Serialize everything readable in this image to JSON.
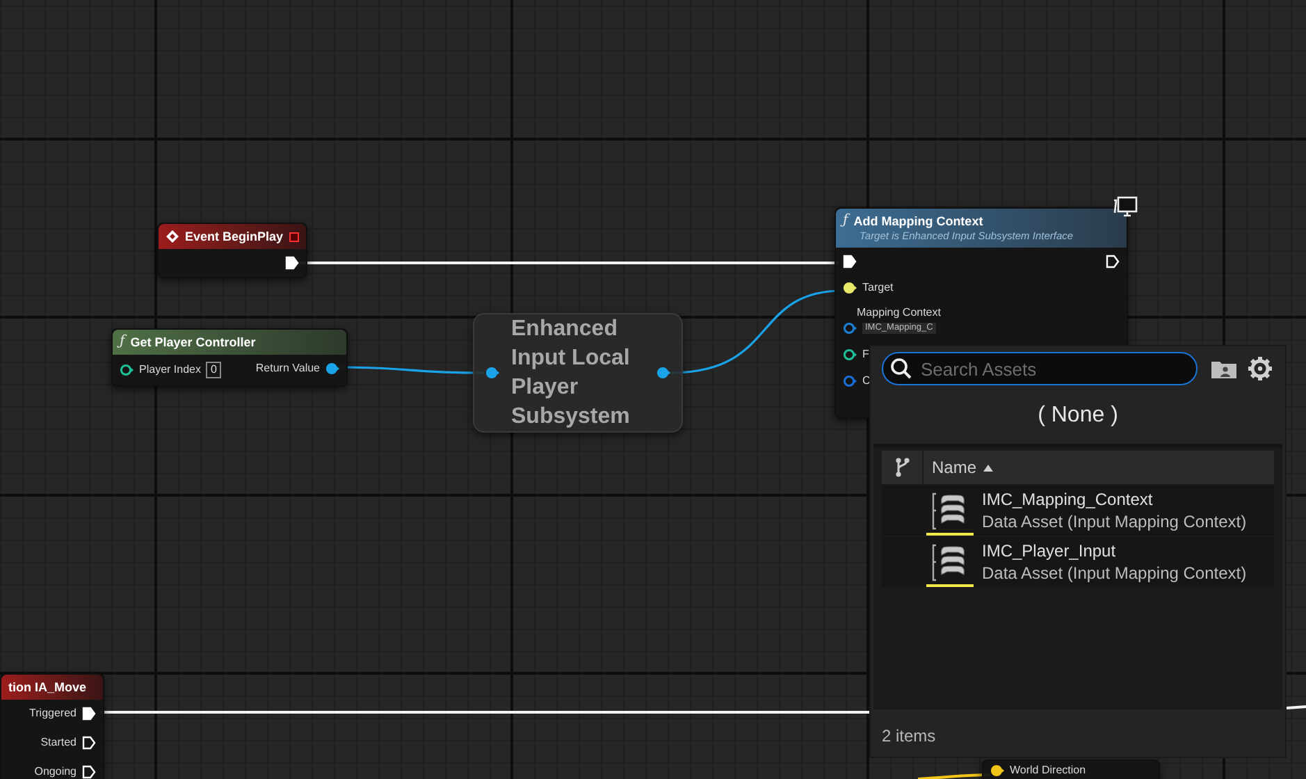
{
  "nodes": [
    {
      "kind": "event",
      "event_icon": true,
      "title": "Event BeginPlay",
      "delegate": true,
      "outputs": [
        {
          "kind": "exec",
          "connected": true,
          "color": "#ffffff"
        }
      ]
    },
    {
      "kind": "pure",
      "icon": "ƒ",
      "title": "Get Player Controller",
      "inputs": [
        {
          "kind": "data",
          "label": "Player Index",
          "value": "0",
          "connected": false,
          "color": "#1fbf9a"
        }
      ],
      "outputs": [
        {
          "kind": "data",
          "label": "Return Value",
          "connected": true,
          "color": "#1aa3e8"
        }
      ]
    },
    {
      "kind": "compact",
      "title": "Enhanced Input Local Player Subsystem",
      "inputs": [
        {
          "kind": "data",
          "connected": true,
          "color": "#1aa3e8"
        }
      ],
      "outputs": [
        {
          "kind": "data",
          "connected": true,
          "color": "#1aa3e8"
        }
      ]
    },
    {
      "kind": "function",
      "icon": "ƒ",
      "title": "Add Mapping Context",
      "subtitle": "Target is Enhanced Input Subsystem Interface",
      "inputs": [
        {
          "kind": "exec",
          "connected": true,
          "color": "#ffffff"
        },
        {
          "kind": "data",
          "label": "Target",
          "connected": true,
          "color": "#e8e86a"
        },
        {
          "kind": "data",
          "label": "Mapping Context",
          "value": "IMC_Mapping_C",
          "connected": false,
          "color": "#1a7fd6"
        },
        {
          "kind": "data",
          "label": "F",
          "connected": false,
          "color": "#1fbf9a"
        },
        {
          "kind": "data",
          "label": "C",
          "connected": false,
          "color": "#1a6fd6"
        }
      ],
      "outputs": [
        {
          "kind": "exec",
          "connected": false,
          "color": "#ffffff"
        }
      ]
    },
    {
      "kind": "event",
      "title": "tion IA_Move",
      "delegate": false,
      "outputs": [
        {
          "kind": "exec",
          "label": "Triggered",
          "connected": true,
          "color": "#ffffff"
        },
        {
          "kind": "exec",
          "label": "Started",
          "connected": false,
          "color": "#ffffff"
        },
        {
          "kind": "exec",
          "label": "Ongoing",
          "connected": false,
          "color": "#ffffff"
        }
      ]
    },
    {
      "kind": "partial",
      "inputs": [
        {
          "kind": "data",
          "label": "World Direction",
          "connected": true,
          "color": "#f0c419"
        }
      ]
    }
  ],
  "asset_picker": {
    "search": {
      "placeholder": "Search Assets"
    },
    "none_label": "( None )",
    "column": {
      "label": "Name",
      "sort_ascending": true
    },
    "assets": [
      {
        "name": "IMC_Mapping_Context",
        "type": "Data Asset (Input Mapping Context)"
      },
      {
        "name": "IMC_Player_Input",
        "type": "Data Asset (Input Mapping Context)"
      }
    ],
    "footer": "2 items"
  }
}
